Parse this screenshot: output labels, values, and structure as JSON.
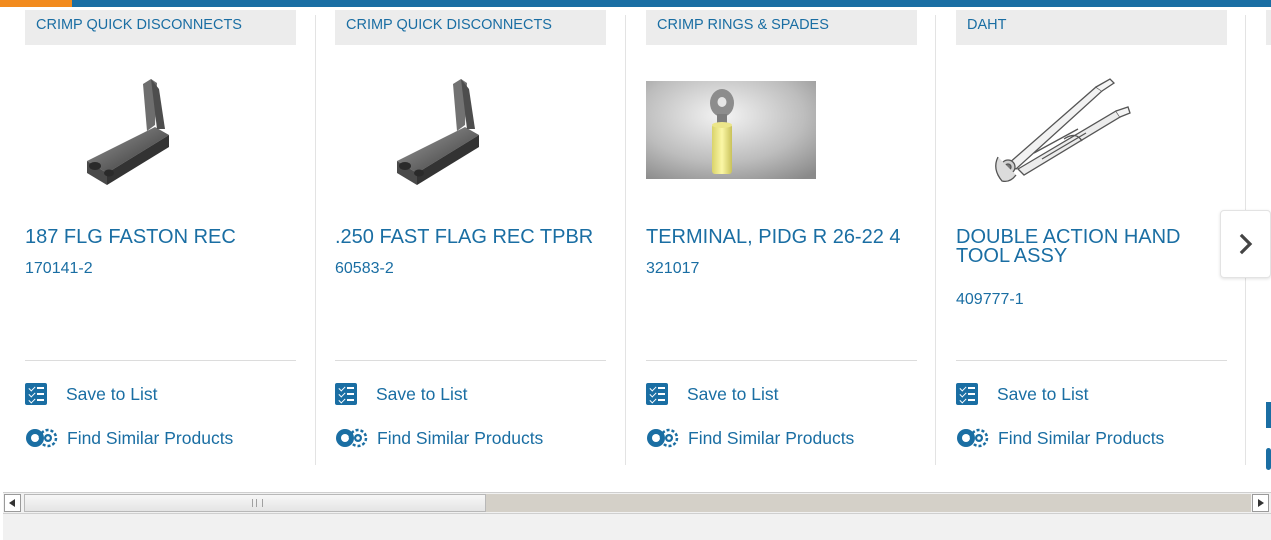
{
  "products": [
    {
      "category": "CRIMP QUICK DISCONNECTS",
      "title": "187 FLG FASTON REC",
      "part_number": "170141-2",
      "image": "flag-receptacle-terminal"
    },
    {
      "category": "CRIMP QUICK DISCONNECTS",
      "title": ".250 FAST FLAG REC TPBR",
      "part_number": "60583-2",
      "image": "flag-receptacle-terminal"
    },
    {
      "category": "CRIMP RINGS & SPADES",
      "title": "TERMINAL, PIDG R 26-22 4",
      "part_number": "321017",
      "image": "yellow-ring-terminal"
    },
    {
      "category": "DAHT",
      "title": "DOUBLE ACTION HAND TOOL ASSY",
      "part_number": "409777-1",
      "image": "hand-crimp-tool"
    }
  ],
  "actions": {
    "save_to_list": "Save to List",
    "find_similar": "Find Similar Products"
  },
  "icons": {
    "save": "checklist-icon",
    "similar": "gears-icon",
    "next": "chevron-right-icon"
  },
  "colors": {
    "brand_blue": "#1a6ea3",
    "accent_orange": "#f28b1e",
    "category_bg": "#ececec"
  }
}
